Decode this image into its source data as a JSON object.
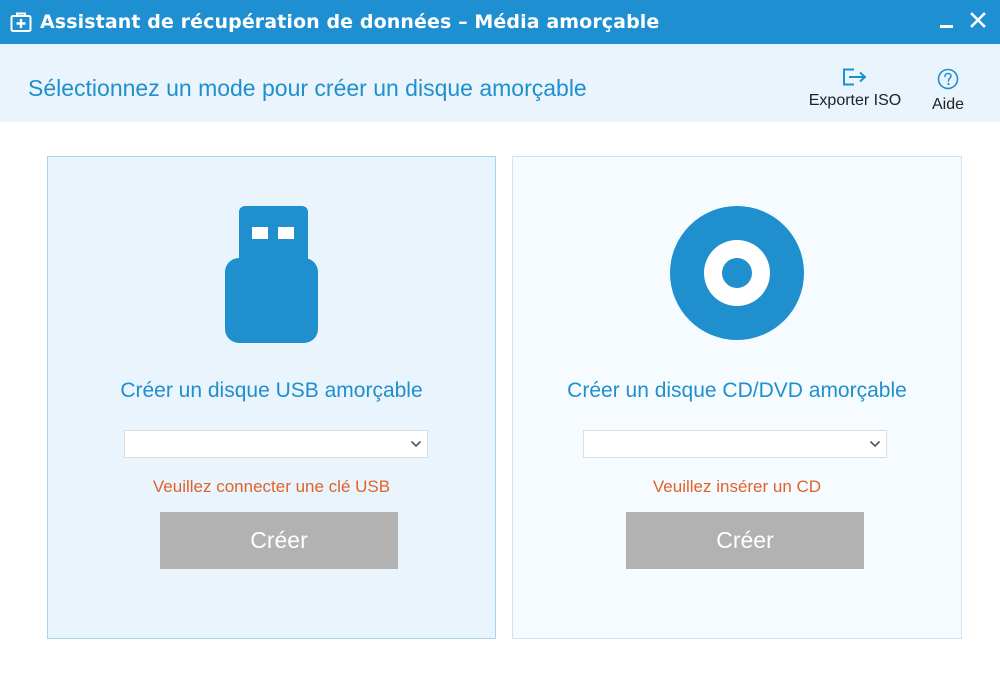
{
  "window": {
    "title": "Assistant de récupération de données – Média amorçable",
    "icon": "medical-kit-icon",
    "minimize_icon": "minimize-icon",
    "close_icon": "close-icon"
  },
  "header": {
    "title": "Sélectionnez un mode pour créer un disque amorçable",
    "tools": {
      "export": {
        "label": "Exporter ISO",
        "icon": "export-icon"
      },
      "help": {
        "label": "Aide",
        "icon": "help-icon"
      }
    }
  },
  "cards": {
    "usb": {
      "icon": "usb-drive-icon",
      "title": "Créer un disque USB amorçable",
      "select_value": "",
      "warning": "Veuillez connecter une clé USB",
      "button_label": "Créer"
    },
    "cd": {
      "icon": "cd-disc-icon",
      "title": "Créer un disque CD/DVD amorçable",
      "select_value": "",
      "warning": "Veuillez insérer un CD",
      "button_label": "Créer"
    }
  },
  "colors": {
    "titlebar": "#1e8fd0",
    "accent": "#1f8fce",
    "header_bg": "#e9f4fd",
    "warning": "#e0632a",
    "button_disabled": "#b2b2b2"
  }
}
